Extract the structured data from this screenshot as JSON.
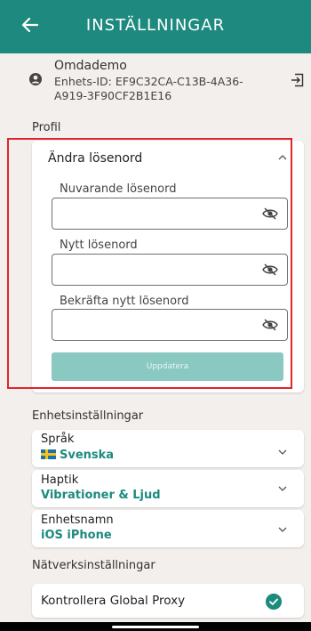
{
  "header": {
    "title": "INSTÄLLNINGAR"
  },
  "user": {
    "name": "Omdademo",
    "device_id": "Enhets-ID: EF9C32CA-C13B-4A36-A919-3F90CF2B1E16"
  },
  "profile": {
    "section_label": "Profil",
    "change_password": {
      "title": "Ändra lösenord",
      "current_label": "Nuvarande lösenord",
      "new_label": "Nytt lösenord",
      "confirm_label": "Bekräfta nytt lösenord",
      "current_value": "",
      "new_value": "",
      "confirm_value": "",
      "update_label": "Uppdatera"
    }
  },
  "device_settings": {
    "section_label": "Enhetsinställningar",
    "language": {
      "label": "Språk",
      "value": "Svenska"
    },
    "haptics": {
      "label": "Haptik",
      "value": "Vibrationer & Ljud"
    },
    "device_name": {
      "label": "Enhetsnamn",
      "value": "iOS iPhone"
    }
  },
  "network_settings": {
    "section_label": "Nätverksinställningar",
    "proxy": {
      "label": "Kontrollera Global Proxy",
      "checked": true
    }
  },
  "colors": {
    "accent": "#1e8a7f",
    "highlight": "#e0242b",
    "button_disabled": "#8ac8c2"
  }
}
